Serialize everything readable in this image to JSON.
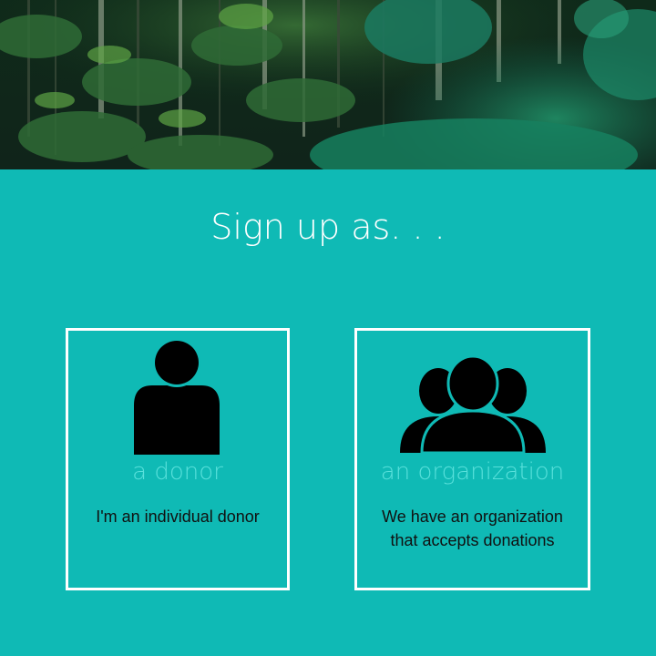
{
  "page": {
    "title": "Sign up as. . ."
  },
  "hero": {
    "image": "jungle-forest-photo"
  },
  "options": {
    "donor": {
      "icon": "person-icon",
      "heading": "a donor",
      "description": "I'm an individual donor"
    },
    "organization": {
      "icon": "group-icon",
      "heading": "an organization",
      "description": "We have an organization\nthat accepts donations"
    }
  },
  "colors": {
    "background": "#0fbab5",
    "card_border": "#ffffff",
    "heading_accent": "#58e0db",
    "title": "#ffffff",
    "icon": "#000000",
    "description": "#111111"
  }
}
